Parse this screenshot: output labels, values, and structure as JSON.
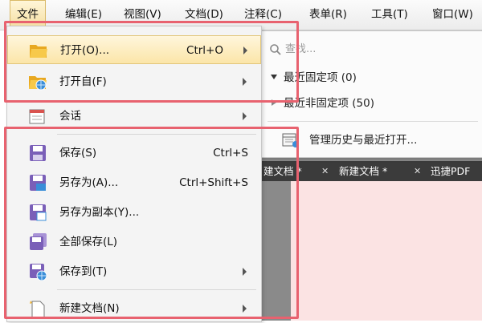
{
  "menubar": {
    "file": "文件",
    "edit": "编辑(E)",
    "view": "视图(V)",
    "document": "文档(D)",
    "comment": "注释(C)",
    "form": "表单(R)",
    "tools": "工具(T)",
    "window": "窗口(W)"
  },
  "file_menu": {
    "open": {
      "label": "打开(O)...",
      "shortcut": "Ctrl+O"
    },
    "open_from": {
      "label": "打开自(F)"
    },
    "session": {
      "label": "会话"
    },
    "save": {
      "label": "保存(S)",
      "shortcut": "Ctrl+S"
    },
    "save_as": {
      "label": "另存为(A)...",
      "shortcut": "Ctrl+Shift+S"
    },
    "save_copy": {
      "label": "另存为副本(Y)..."
    },
    "save_all": {
      "label": "全部保存(L)"
    },
    "save_to": {
      "label": "保存到(T)"
    },
    "new_doc": {
      "label": "新建文档(N)"
    }
  },
  "open_submenu": {
    "search_placeholder": "查找...",
    "pinned": "最近固定项 (0)",
    "unpinned": "最近非固定项 (50)",
    "history": "管理历史与最近打开..."
  },
  "tabs": [
    {
      "label": "建文档 *"
    },
    {
      "label": "新建文档 *"
    },
    {
      "label": "迅捷PDF"
    }
  ],
  "colors": {
    "highlight": "#fbe5a8",
    "annotation_red": "#e8626f",
    "folder": "#f2b634",
    "save_purple": "#7a5fb8"
  }
}
